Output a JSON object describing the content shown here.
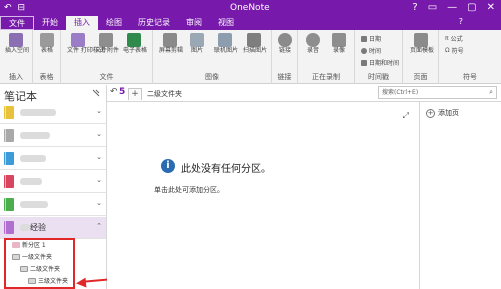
{
  "window": {
    "title": "OneNote",
    "controls": [
      "?",
      "▭",
      "—",
      "▢",
      "✕"
    ],
    "account": "?"
  },
  "tabs": [
    {
      "label": "文件"
    },
    {
      "label": "开始"
    },
    {
      "label": "插入"
    },
    {
      "label": "绘图"
    },
    {
      "label": "历史记录"
    },
    {
      "label": "审阅"
    },
    {
      "label": "视图"
    }
  ],
  "ribbon": {
    "insert_space": "插入空间",
    "table": "表格",
    "file_printout": "文件\n打印样式",
    "file_attachment": "文件附件",
    "spreadsheet": "电子表格",
    "screen_clipping": "屏幕剪辑",
    "picture": "图片",
    "online_picture": "联机图片",
    "scan_picture": "扫描图片",
    "link": "链接",
    "audio": "录音",
    "video": "录像",
    "date": "日期",
    "time": "时间",
    "date_time": "日期和时间",
    "page_templates": "页面模板",
    "equation": "公式",
    "symbol": "符号",
    "groups": {
      "insert": "插入",
      "tables": "表格",
      "files": "文件",
      "images": "图像",
      "links": "链接",
      "recording": "正在录制",
      "timestamp": "时间戳",
      "pages": "页面",
      "symbols": "符号"
    }
  },
  "left_pane": {
    "header": "笔记本",
    "notebooks": [
      {
        "color": "#e8c23a"
      },
      {
        "color": "#a9a9a9"
      },
      {
        "color": "#3d9bd9"
      },
      {
        "color": "#d9455f"
      },
      {
        "color": "#4cae4c"
      },
      {
        "color": "#b06fce",
        "label": "经验",
        "open": true
      }
    ],
    "tree": [
      {
        "label": "新分区 1",
        "kind": "section"
      },
      {
        "label": "一级文件夹",
        "kind": "folder"
      },
      {
        "label": "二级文件夹",
        "kind": "folder"
      },
      {
        "label": "三级文件夹",
        "kind": "folder"
      }
    ]
  },
  "section_bar": {
    "back_glyph": "↶",
    "count": "5",
    "add_tab": "+",
    "breadcrumb": "二级文件夹",
    "search_placeholder": "搜索(Ctrl+E)"
  },
  "canvas": {
    "message": "此处没有任何分区。",
    "hint": "单击此处可添加分区。"
  },
  "right_pane": {
    "add_page": "添加页"
  },
  "colors": {
    "accent": "#7719aa",
    "annotation": "#e0282a",
    "info": "#2b6cb0"
  }
}
